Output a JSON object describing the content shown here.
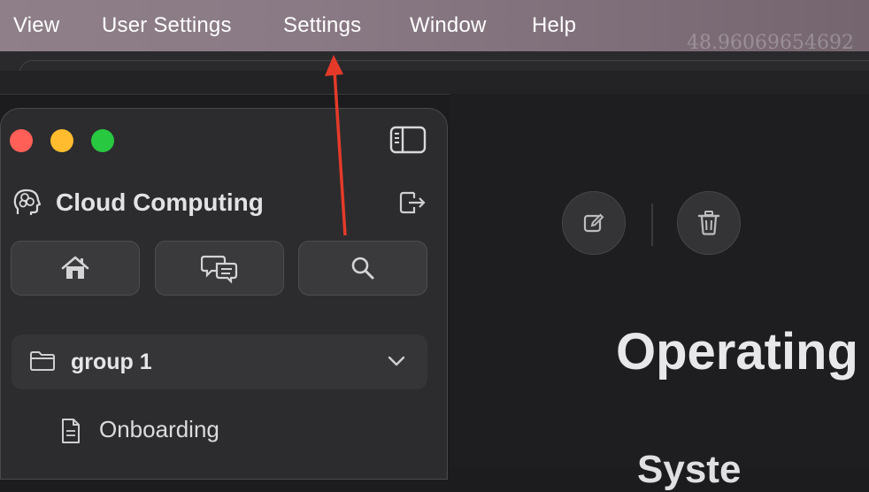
{
  "menubar": {
    "items": [
      "View",
      "User Settings",
      "Settings",
      "Window",
      "Help"
    ],
    "coordinate_readout": "48.96069654692"
  },
  "sidebar": {
    "app_title": "Cloud Computing",
    "nav_buttons": [
      "home-icon",
      "chat-icon",
      "search-icon"
    ],
    "group": {
      "label": "group 1",
      "expanded": true
    },
    "items": [
      {
        "label": "Onboarding",
        "icon": "document-icon"
      }
    ]
  },
  "content": {
    "actions": [
      "edit-icon",
      "trash-icon"
    ],
    "title": "Operating",
    "next_heading": "Syste"
  },
  "colors": {
    "close": "#ff5f57",
    "minimize": "#febc2e",
    "zoom": "#28c840",
    "annotation_arrow": "#e53a2a"
  }
}
